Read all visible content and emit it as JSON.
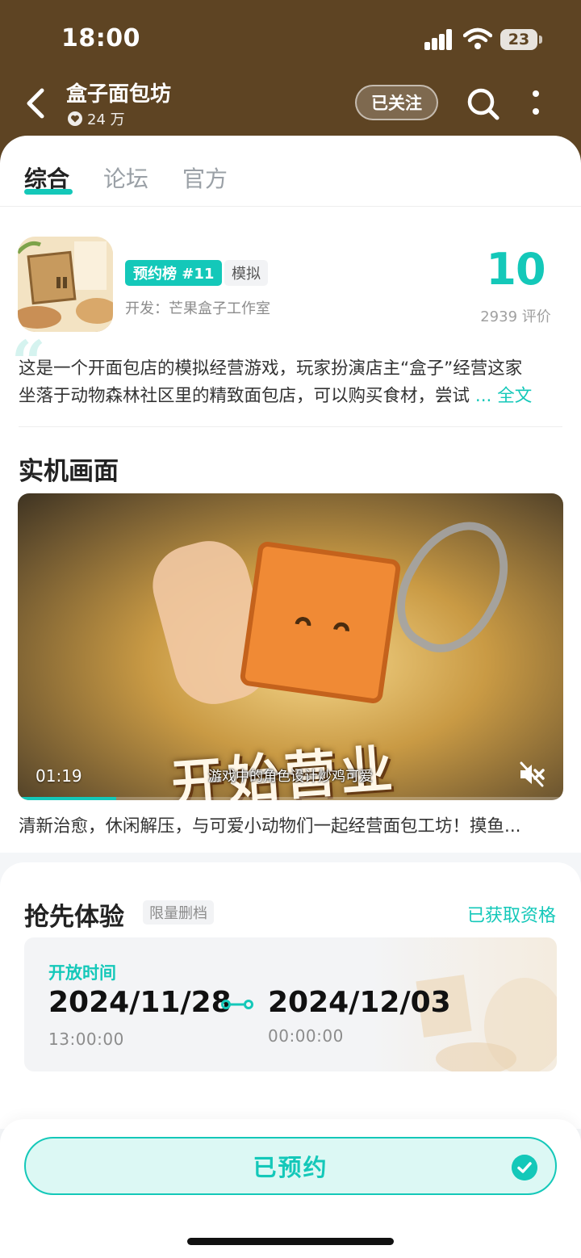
{
  "status_bar": {
    "time": "18:00",
    "battery": "23"
  },
  "header": {
    "title": "盒子面包坊",
    "followers": "24 万",
    "follow_button": "已关注"
  },
  "tabs": [
    {
      "label": "综合",
      "active": true
    },
    {
      "label": "论坛",
      "active": false
    },
    {
      "label": "官方",
      "active": false
    }
  ],
  "game": {
    "rank_tag": "预约榜 #11",
    "genre_tag": "模拟",
    "developer": "开发：芒果盒子工作室",
    "score": "10",
    "rating_count": "2939 评价",
    "description_line1": "这是一个开面包店的模拟经营游戏，玩家扮演店主“盒子”经营这家",
    "description_line2": "坐落于动物森林社区里的精致面包店，可以购买食材，尝试",
    "more_link": "... 全文"
  },
  "screenshots": {
    "title": "实机画面",
    "video_time": "01:19",
    "video_subtitle": "游戏中的角色设计炒鸡可爱",
    "video_banner": "开始营业",
    "video_progress": 0.18,
    "caption": "清新治愈，休闲解压，与可爱小动物们一起经营面包工坊！摸鱼..."
  },
  "early_access": {
    "title": "抢先体验",
    "tag": "限量删档",
    "status": "已获取资格",
    "open_time_label": "开放时间",
    "start_date": "2024/11/28",
    "start_time": "13:00:00",
    "end_date": "2024/12/03",
    "end_time": "00:00:00"
  },
  "bottom": {
    "reserve_button": "已预约"
  },
  "colors": {
    "accent": "#14c8b9",
    "header_brown": "#5e4423"
  }
}
